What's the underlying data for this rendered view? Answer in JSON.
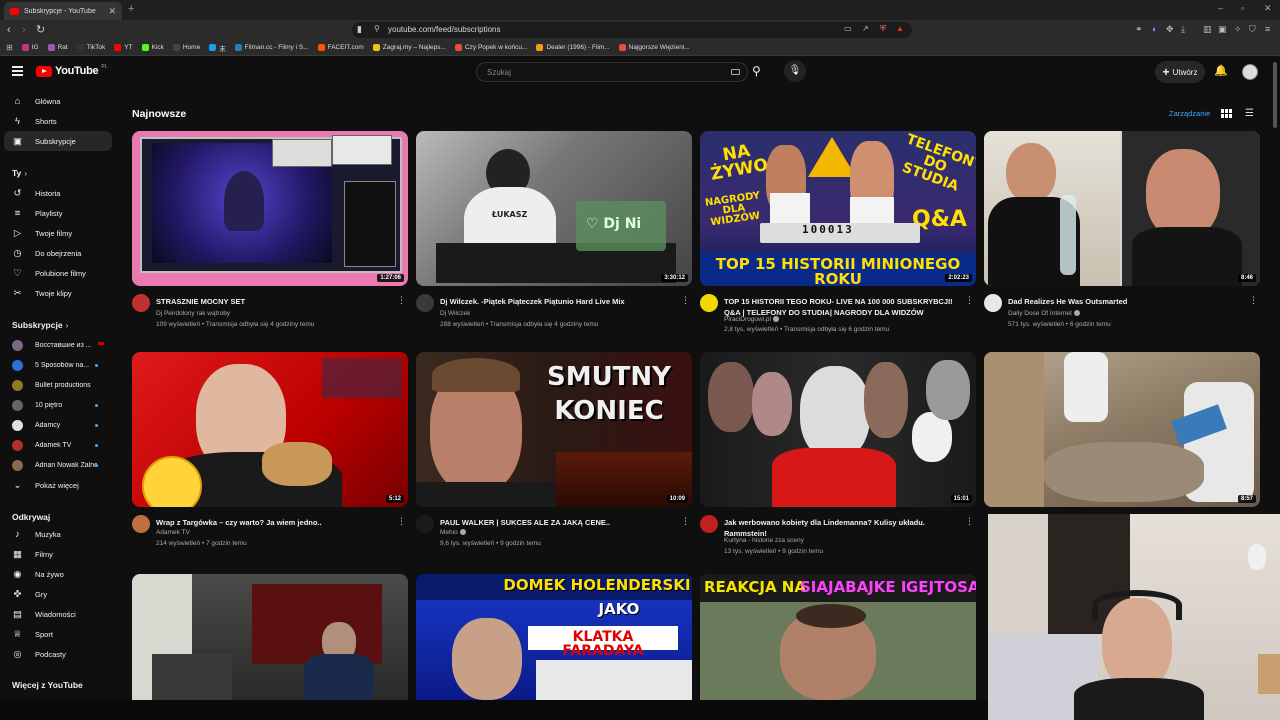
{
  "browser": {
    "tab_title": "Subskrypcje - YouTube",
    "url": "youtube.com/feed/subscriptions",
    "bookmarks": [
      {
        "label": "IG",
        "color": "#c13584"
      },
      {
        "label": "Rat",
        "color": "#9b59b6"
      },
      {
        "label": "TikTok",
        "color": "#333333"
      },
      {
        "label": "YT",
        "color": "#ff0000"
      },
      {
        "label": "Kick",
        "color": "#53fc18"
      },
      {
        "label": "Home",
        "color": "#444444"
      },
      {
        "label": "末",
        "color": "#1d9bf0"
      },
      {
        "label": "Filman.cc - Filmy i S...",
        "color": "#2980b9"
      },
      {
        "label": "FACEIT.com",
        "color": "#ff5500"
      },
      {
        "label": "Zagraj.my – Najleps...",
        "color": "#f1c40f"
      },
      {
        "label": "Czy Popek w końcu...",
        "color": "#e74c3c"
      },
      {
        "label": "Dealer (1996) - Film...",
        "color": "#f39c12"
      },
      {
        "label": "Najgorsze Więzieni...",
        "color": "#e74c3c"
      }
    ]
  },
  "header": {
    "logo": "YouTube",
    "logo_country": "PL",
    "search_placeholder": "Szukaj",
    "create_label": "Utwórz"
  },
  "sidebar": {
    "main": [
      {
        "label": "Główna",
        "icon": "home-icon",
        "glyph": "⌂"
      },
      {
        "label": "Shorts",
        "icon": "shorts-icon",
        "glyph": "ϟ"
      },
      {
        "label": "Subskrypcje",
        "icon": "subscriptions-icon",
        "glyph": "▣"
      }
    ],
    "you_header": "Ty",
    "you": [
      {
        "label": "Historia",
        "icon": "history-icon",
        "glyph": "↺"
      },
      {
        "label": "Playlisty",
        "icon": "playlists-icon",
        "glyph": "≡"
      },
      {
        "label": "Twoje filmy",
        "icon": "your-videos-icon",
        "glyph": "▷"
      },
      {
        "label": "Do obejrzenia",
        "icon": "watch-later-icon",
        "glyph": "◷"
      },
      {
        "label": "Polubione filmy",
        "icon": "liked-icon",
        "glyph": "♡"
      },
      {
        "label": "Twoje klipy",
        "icon": "clips-icon",
        "glyph": "✂"
      }
    ],
    "subs_header": "Subskrypcje",
    "subs": [
      {
        "label": "Восставшие из ...",
        "color": "#7a6a8a",
        "live": true
      },
      {
        "label": "5 Sposobów na...",
        "color": "#2f6fd0",
        "dot": true
      },
      {
        "label": "Bullet productions",
        "color": "#8a7a2a"
      },
      {
        "label": "10 piętro",
        "color": "#666666",
        "dot": true
      },
      {
        "label": "Adamcy",
        "color": "#e0e0e0",
        "dot": true
      },
      {
        "label": "Adamek TV",
        "color": "#b03030",
        "dot": true
      },
      {
        "label": "Adrian Nowak Żalno",
        "color": "#8a6a4a",
        "dot": true
      }
    ],
    "show_more": "Pokaż więcej",
    "explore_header": "Odkrywaj",
    "explore": [
      {
        "label": "Muzyka",
        "icon": "music-icon",
        "glyph": "♪"
      },
      {
        "label": "Filmy",
        "icon": "movies-icon",
        "glyph": "▦"
      },
      {
        "label": "Na żywo",
        "icon": "live-icon",
        "glyph": "◉"
      },
      {
        "label": "Gry",
        "icon": "gaming-icon",
        "glyph": "✜"
      },
      {
        "label": "Wiadomości",
        "icon": "news-icon",
        "glyph": "▤"
      },
      {
        "label": "Sport",
        "icon": "sport-icon",
        "glyph": "♕"
      },
      {
        "label": "Podcasty",
        "icon": "podcasts-icon",
        "glyph": "◎"
      }
    ],
    "more_header": "Więcej z YouTube"
  },
  "main": {
    "title": "Najnowsze",
    "manage_label": "Zarządzanie"
  },
  "videos": [
    {
      "title": "STRASZNIE MOCNY SET",
      "channel": "Dj Peirdolony rak wątroby",
      "verified": false,
      "stats": "109 wyświetleń • Transmisja odbyła się 4 godziny temu",
      "duration": "1:27:06",
      "av": "#c03030"
    },
    {
      "title": "Dj Wilczek. -Piątek Piąteczek Piątunio Hard Live Mix",
      "channel": "Dj Wilczek",
      "verified": false,
      "stats": "288 wyświetleń • Transmisja odbyła się 4 godziny temu",
      "duration": "3:30:12",
      "av": "#3a3a3a"
    },
    {
      "title": "TOP 15 HISTORII TEGO ROKU- LIVE NA 100 000 SUBSKRYBCJI! Q&A | TELEFONY DO STUDIA| NAGRODY DLA WIDZÓW",
      "channel": "PiraciDrogowi.pl",
      "verified": true,
      "stats": "2,8 tys. wyświetleń • Transmisja odbyła się 6 godzin temu",
      "duration": "2:02:23",
      "av": "#f2d800"
    },
    {
      "title": "Dad Realizes He Was Outsmarted",
      "channel": "Daily Dose Of Internet",
      "verified": true,
      "stats": "571 tys. wyświetleń • 6 godzin temu",
      "duration": "8:46",
      "av": "#e8e8e8"
    },
    {
      "title": "Wrap z Targówka – czy warto? Ja wiem jedno..",
      "channel": "Adamek TV",
      "verified": false,
      "stats": "214 wyświetleń • 7 godzin temu",
      "duration": "5:12",
      "av": "#c07040"
    },
    {
      "title": "PAUL WALKER | SUKCES ALE ZA JAKĄ CENE..",
      "channel": "Mehio",
      "verified": true,
      "stats": "9,6 tys. wyświetleń • 9 godzin temu",
      "duration": "10:09",
      "av": "#1a1a1a"
    },
    {
      "title": "Jak werbowano kobiety dla Lindemanna? Kulisy układu. Rammstein!",
      "channel": "Kurtyna - historie zza sceny",
      "verified": false,
      "stats": "13 tys. wyświetleń • 9 godzin temu",
      "duration": "15:01",
      "av": "#c02020"
    },
    {
      "title": "",
      "channel": "",
      "verified": false,
      "stats": "",
      "duration": "8:57",
      "av": "#0f0f0f"
    }
  ],
  "thumb_text": {
    "v2_dj": "♡ Dj Ni",
    "v2_shirt": "ŁUKASZ",
    "v3_top_left": "NA ŻYWO",
    "v3_top_right": "TELEFONY DO STUDIA",
    "v3_nagrody": "NAGRODY DLA WIDZÓW",
    "v3_qa": "Q&A",
    "v3_counter": "100013",
    "v3_bottom": "TOP 15 HISTORII MINIONEGO ROKU",
    "v6_title1": "SMUTNY",
    "v6_title2": "KONIEC",
    "v9_title1": "DOMEK HOLENDERSKI",
    "v9_title2": "JAKO",
    "v9_title3": "KLATKA FARADAYA",
    "v10_title1": "REAKCJA NA",
    "v10_title2": "SIAJABAJKE I",
    "v10_title3": "GEJTOSA"
  },
  "colors": {
    "accent_link": "#3ea6ff",
    "brand_red": "#ff0000",
    "bg": "#0f0f0f"
  }
}
